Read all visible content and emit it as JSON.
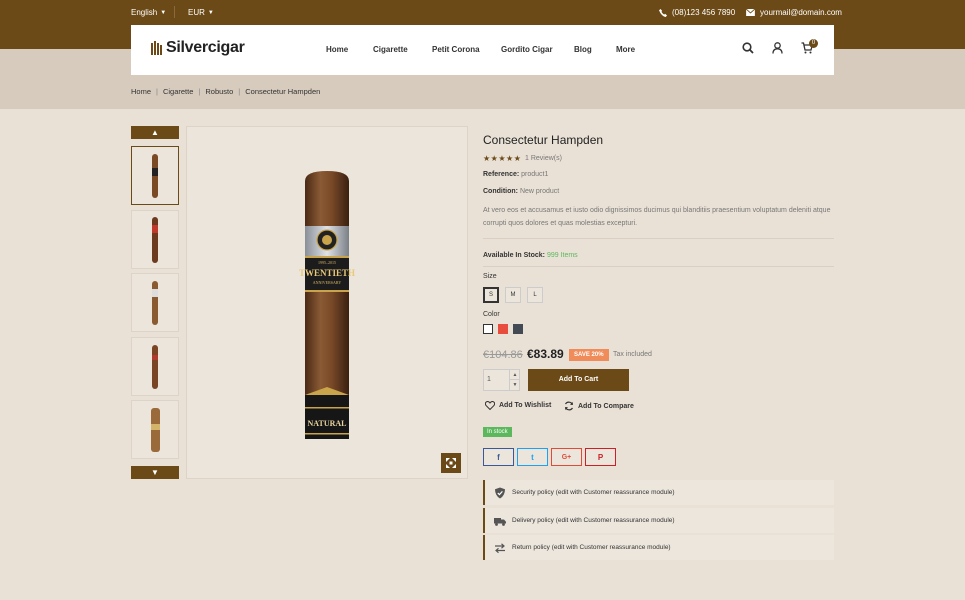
{
  "topbar": {
    "language": "English",
    "currency": "EUR",
    "phone": "(08)123 456 7890",
    "email": "yourmail@domain.com"
  },
  "header": {
    "logo_text": "Silvercigar",
    "nav": [
      "Home",
      "Cigarette",
      "Petit Corona",
      "Gordito Cigar",
      "Blog",
      "More"
    ],
    "cart_count": "0"
  },
  "breadcrumb": [
    "Home",
    "Cigarette",
    "Robusto",
    "Consectetur Hampden"
  ],
  "product": {
    "title": "Consectetur Hampden",
    "rating": 5,
    "stars": "★★★★★",
    "reviews": "1 Review(s)",
    "reference_label": "Reference:",
    "reference": "product1",
    "condition_label": "Condition:",
    "condition": "New product",
    "description": "At vero eos et accusamus et iusto odio dignissimos ducimus qui blanditiis praesentium voluptatum deleniti atque corrupti quos dolores et quas molestias excepturi.",
    "stock_label": "Available In Stock:",
    "stock_value": "999 Items",
    "size_label": "Size",
    "sizes": [
      "S",
      "M",
      "L"
    ],
    "selected_size": "S",
    "color_label": "Color",
    "colors": [
      "#ffffff",
      "#e74c3c",
      "#434a54"
    ],
    "old_price": "€104.86",
    "price": "€83.89",
    "save_badge": "SAVE 20%",
    "tax_note": "Tax included",
    "quantity": "1",
    "add_to_cart": "Add To Cart",
    "wishlist": "Add To Wishlist",
    "compare": "Add To Compare",
    "in_stock_badge": "In stock",
    "cigar_band_text": "TWENTIETH",
    "cigar_band_sub": "ANNIVERSARY",
    "cigar_band_year": "1995–2015",
    "cigar_foot_text": "NATURAL"
  },
  "share": {
    "facebook": "f",
    "twitter": "t",
    "google": "G+",
    "pinterest": "P"
  },
  "reassurance": [
    "Security policy (edit with Customer reassurance module)",
    "Delivery policy (edit with Customer reassurance module)",
    "Return policy (edit with Customer reassurance module)"
  ],
  "colors": {
    "brand": "#6b4a17",
    "background": "#e9e1d6",
    "green": "#5cb85c",
    "save": "#f08c5a"
  }
}
